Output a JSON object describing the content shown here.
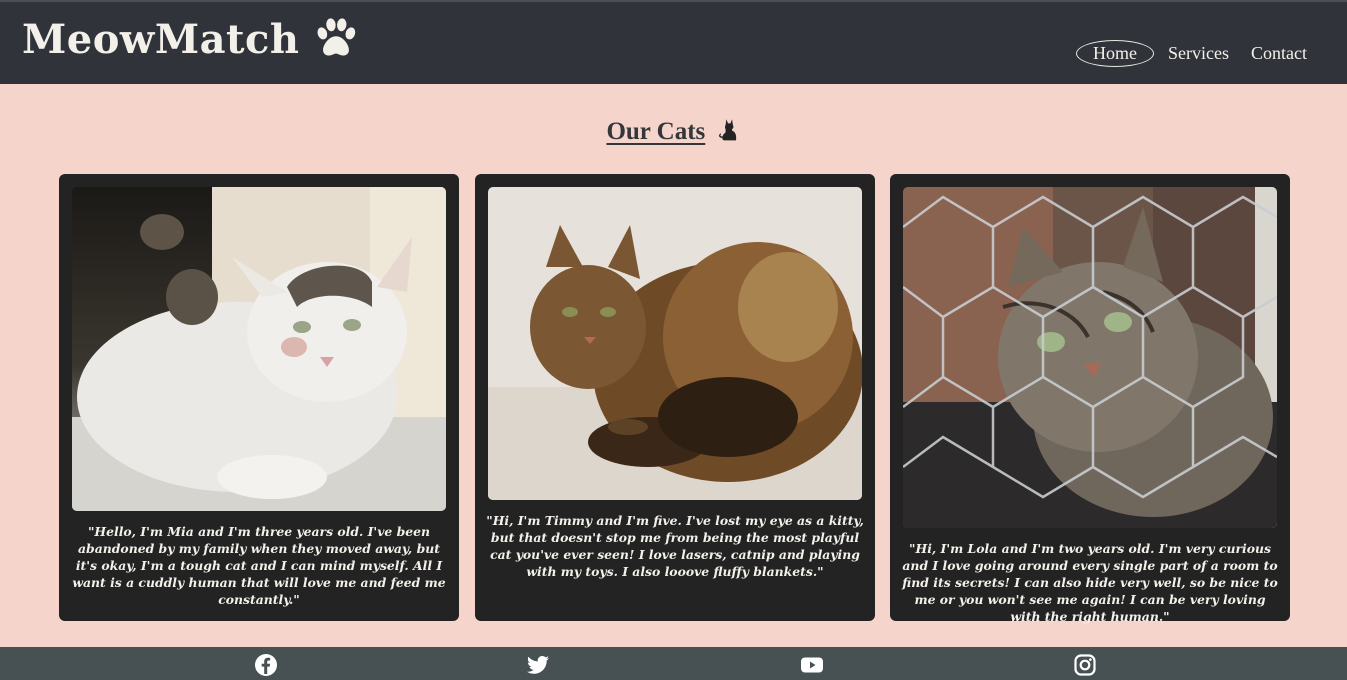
{
  "header": {
    "brand": "MeowMatch",
    "brand_icon": "paw-icon",
    "nav": [
      {
        "label": "Home",
        "active": true
      },
      {
        "label": "Services",
        "active": false
      },
      {
        "label": "Contact",
        "active": false
      }
    ]
  },
  "main": {
    "title": "Our Cats",
    "title_icon": "cat-icon",
    "cards": [
      {
        "name": "Mia",
        "caption": "\"Hello, I'm Mia and I'm three years old. I've been abandoned by my family when they moved away, but it's okay, I'm a tough cat and I can mind myself. All I want is a cuddly human that will love me and feed me constantly.\""
      },
      {
        "name": "Timmy",
        "caption": "\"Hi, I'm Timmy and I'm five. I've lost my eye as a kitty, but that doesn't stop me from being the most playful cat you've ever seen! I love lasers, catnip and playing with my toys. I also looove fluffy blankets.\""
      },
      {
        "name": "Lola",
        "caption": "\"Hi, I'm Lola and I'm two years old. I'm very curious and I love going around every single part of a room to find its secrets! I can also hide very well, so be nice to me or you won't see me again! I can be very loving with the right human.\""
      }
    ]
  },
  "footer": {
    "social": [
      "facebook-icon",
      "twitter-icon",
      "youtube-icon",
      "instagram-icon"
    ]
  },
  "colors": {
    "header_bg": "#30343a",
    "page_bg": "#f5d5cb",
    "card_bg": "#232323",
    "footer_bg": "#475153"
  }
}
